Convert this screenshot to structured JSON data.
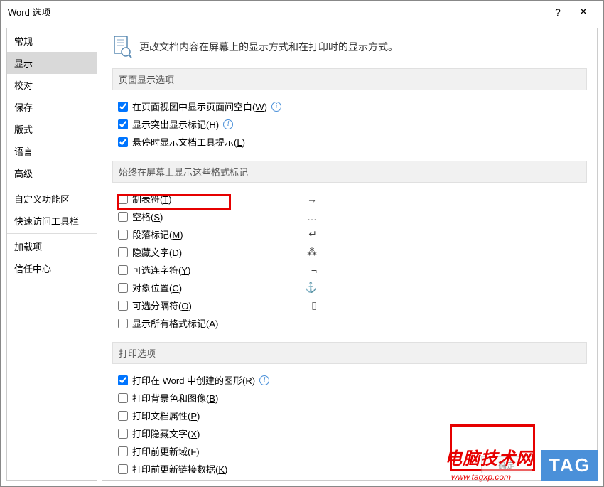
{
  "titlebar": {
    "title": "Word 选项",
    "help": "?",
    "close": "✕"
  },
  "sidebar": {
    "items": [
      {
        "label": "常规",
        "selected": false
      },
      {
        "label": "显示",
        "selected": true
      },
      {
        "label": "校对",
        "selected": false
      },
      {
        "label": "保存",
        "selected": false
      },
      {
        "label": "版式",
        "selected": false
      },
      {
        "label": "语言",
        "selected": false
      },
      {
        "label": "高级",
        "selected": false
      }
    ],
    "items2": [
      {
        "label": "自定义功能区"
      },
      {
        "label": "快速访问工具栏"
      }
    ],
    "items3": [
      {
        "label": "加载项"
      },
      {
        "label": "信任中心"
      }
    ]
  },
  "header": {
    "desc": "更改文档内容在屏幕上的显示方式和在打印时的显示方式。"
  },
  "section1": {
    "title": "页面显示选项",
    "opts": [
      {
        "label": "在页面视图中显示页面间空白(",
        "key": "W",
        "suffix": ")",
        "checked": true,
        "info": true
      },
      {
        "label": "显示突出显示标记(",
        "key": "H",
        "suffix": ")",
        "checked": true,
        "info": true
      },
      {
        "label": "悬停时显示文档工具提示(",
        "key": "L",
        "suffix": ")",
        "checked": true,
        "info": false
      }
    ]
  },
  "section2": {
    "title": "始终在屏幕上显示这些格式标记",
    "opts": [
      {
        "label": "制表符(",
        "key": "T",
        "suffix": ")",
        "checked": false,
        "sym": "→"
      },
      {
        "label": "空格(",
        "key": "S",
        "suffix": ")",
        "checked": false,
        "sym": "…"
      },
      {
        "label": "段落标记(",
        "key": "M",
        "suffix": ")",
        "checked": false,
        "sym": "↵"
      },
      {
        "label": "隐藏文字(",
        "key": "D",
        "suffix": ")",
        "checked": false,
        "sym": "⁂"
      },
      {
        "label": "可选连字符(",
        "key": "Y",
        "suffix": ")",
        "checked": false,
        "sym": "¬"
      },
      {
        "label": "对象位置(",
        "key": "C",
        "suffix": ")",
        "checked": false,
        "sym": "⚓"
      },
      {
        "label": "可选分隔符(",
        "key": "O",
        "suffix": ")",
        "checked": false,
        "sym": "▯"
      },
      {
        "label": "显示所有格式标记(",
        "key": "A",
        "suffix": ")",
        "checked": false,
        "sym": ""
      }
    ]
  },
  "section3": {
    "title": "打印选项",
    "opts": [
      {
        "label": "打印在 Word 中创建的图形(",
        "key": "R",
        "suffix": ")",
        "checked": true,
        "info": true
      },
      {
        "label": "打印背景色和图像(",
        "key": "B",
        "suffix": ")",
        "checked": false,
        "info": false
      },
      {
        "label": "打印文档属性(",
        "key": "P",
        "suffix": ")",
        "checked": false,
        "info": false
      },
      {
        "label": "打印隐藏文字(",
        "key": "X",
        "suffix": ")",
        "checked": false,
        "info": false
      },
      {
        "label": "打印前更新域(",
        "key": "F",
        "suffix": ")",
        "checked": false,
        "info": false
      },
      {
        "label": "打印前更新链接数据(",
        "key": "K",
        "suffix": ")",
        "checked": false,
        "info": false
      }
    ]
  },
  "footer": {
    "ok": "确定"
  },
  "overlay": {
    "watermark": "电脑技术网",
    "watermark_url": "www.tagxp.com",
    "tag": "TAG"
  }
}
